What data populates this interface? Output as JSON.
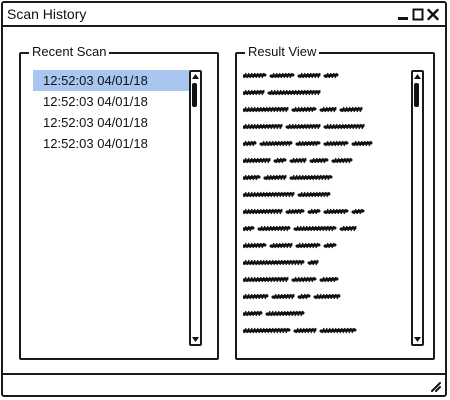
{
  "window": {
    "title": "Scan History",
    "controls": [
      "minimize-icon",
      "maximize-icon",
      "close-icon"
    ]
  },
  "recent_scan": {
    "label": "Recent Scan",
    "items": [
      {
        "text": "12:52:03 04/01/18",
        "selected": true
      },
      {
        "text": "12:52:03 04/01/18",
        "selected": false
      },
      {
        "text": "12:52:03 04/01/18",
        "selected": false
      },
      {
        "text": "12:52:03 04/01/18",
        "selected": false
      }
    ]
  },
  "result_view": {
    "label": "Result View",
    "content": "placeholder-scribble"
  },
  "colors": {
    "selection": "#a8c6f0",
    "border": "#1a1a1a"
  }
}
